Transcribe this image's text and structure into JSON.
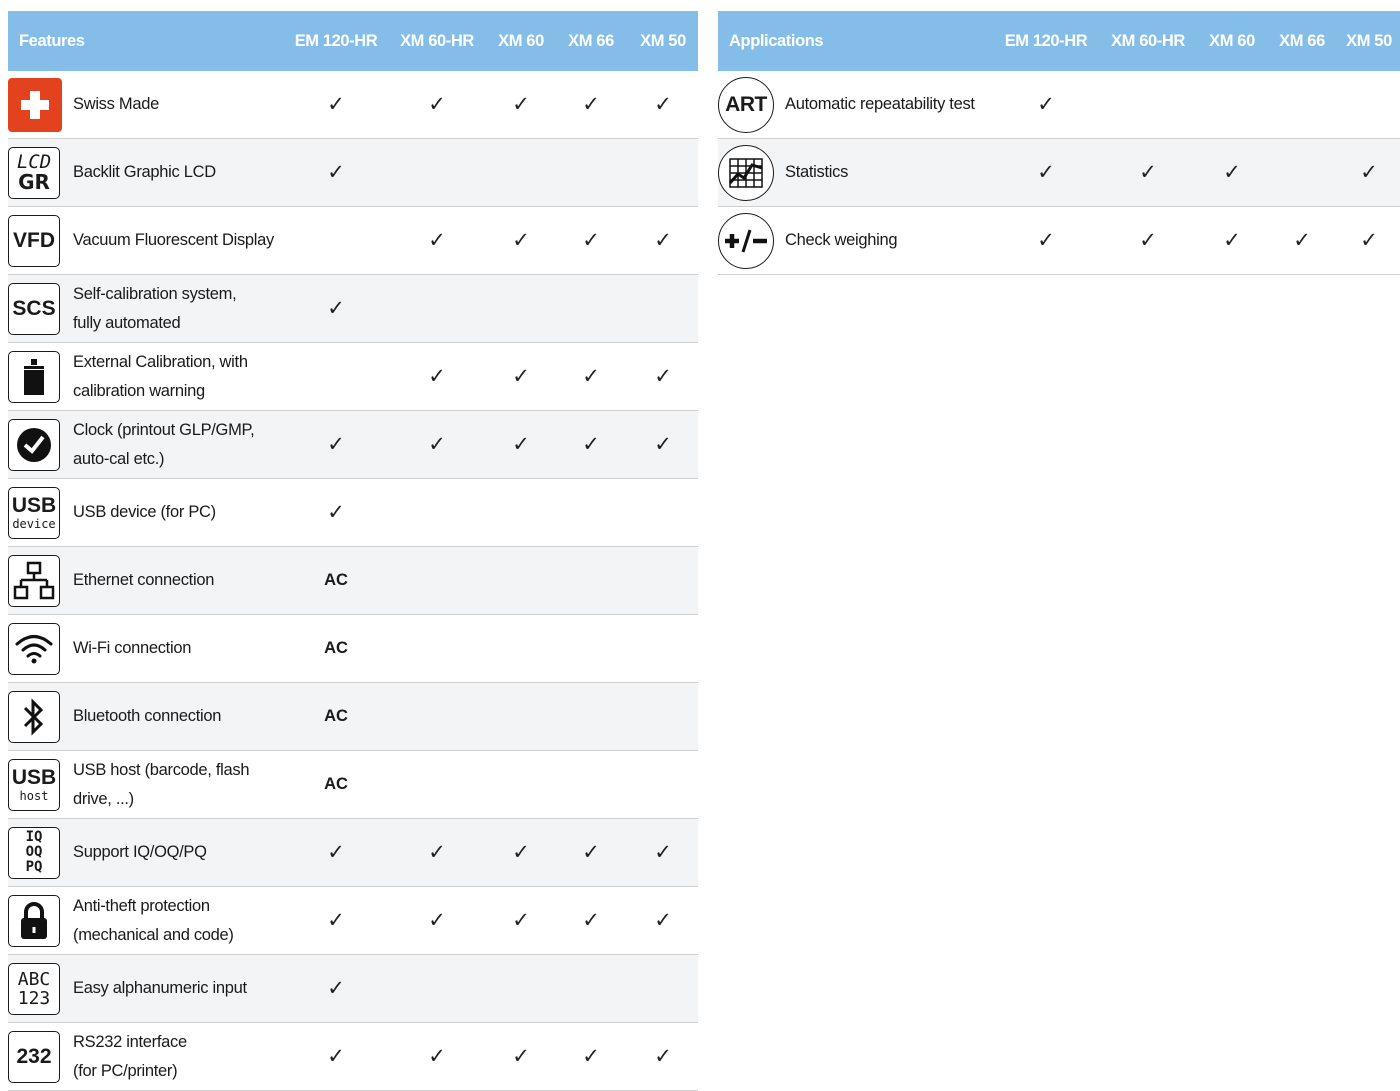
{
  "features": {
    "header": "Features",
    "columns": [
      "EM 120-HR",
      "XM 60-HR",
      "XM 60",
      "XM 66",
      "XM 50"
    ],
    "rows": [
      {
        "icon": "swiss-flag-icon",
        "label_lines": [
          "Swiss Made"
        ],
        "marks": [
          "✓",
          "✓",
          "✓",
          "✓",
          "✓"
        ]
      },
      {
        "icon": "lcd-gr-icon",
        "label_lines": [
          "Backlit Graphic LCD"
        ],
        "marks": [
          "✓",
          "",
          "",
          "",
          ""
        ]
      },
      {
        "icon": "vfd-icon",
        "label_lines": [
          "Vacuum Fluorescent Display"
        ],
        "marks": [
          "",
          "✓",
          "✓",
          "✓",
          "✓"
        ]
      },
      {
        "icon": "scs-icon",
        "label_lines": [
          "Self-calibration system,",
          "fully automated"
        ],
        "marks": [
          "✓",
          "",
          "",
          "",
          ""
        ]
      },
      {
        "icon": "calibration-weight-icon",
        "label_lines": [
          "External Calibration, with",
          "calibration warning"
        ],
        "marks": [
          "",
          "✓",
          "✓",
          "✓",
          "✓"
        ]
      },
      {
        "icon": "clock-icon",
        "label_lines": [
          "Clock (printout GLP/GMP,",
          "auto-cal etc.)"
        ],
        "marks": [
          "✓",
          "✓",
          "✓",
          "✓",
          "✓"
        ]
      },
      {
        "icon": "usb-device-icon",
        "label_lines": [
          "USB device (for PC)"
        ],
        "marks": [
          "✓",
          "",
          "",
          "",
          ""
        ]
      },
      {
        "icon": "ethernet-icon",
        "label_lines": [
          "Ethernet connection"
        ],
        "marks": [
          "AC",
          "",
          "",
          "",
          ""
        ]
      },
      {
        "icon": "wifi-icon",
        "label_lines": [
          "Wi-Fi connection"
        ],
        "marks": [
          "AC",
          "",
          "",
          "",
          ""
        ]
      },
      {
        "icon": "bluetooth-icon",
        "label_lines": [
          "Bluetooth connection"
        ],
        "marks": [
          "AC",
          "",
          "",
          "",
          ""
        ]
      },
      {
        "icon": "usb-host-icon",
        "label_lines": [
          "USB host (barcode, flash",
          "drive, ...)"
        ],
        "marks": [
          "AC",
          "",
          "",
          "",
          ""
        ]
      },
      {
        "icon": "iq-oq-pq-icon",
        "label_lines": [
          "Support IQ/OQ/PQ"
        ],
        "marks": [
          "✓",
          "✓",
          "✓",
          "✓",
          "✓"
        ]
      },
      {
        "icon": "padlock-icon",
        "label_lines": [
          "Anti-theft protection",
          "(mechanical and code)"
        ],
        "marks": [
          "✓",
          "✓",
          "✓",
          "✓",
          "✓"
        ]
      },
      {
        "icon": "abc-123-icon",
        "label_lines": [
          "Easy alphanumeric input"
        ],
        "marks": [
          "✓",
          "",
          "",
          "",
          ""
        ]
      },
      {
        "icon": "rs232-icon",
        "label_lines": [
          "RS232 interface",
          "(for PC/printer)"
        ],
        "marks": [
          "✓",
          "✓",
          "✓",
          "✓",
          "✓"
        ]
      }
    ]
  },
  "applications": {
    "header": "Applications",
    "columns": [
      "EM 120-HR",
      "XM 60-HR",
      "XM 60",
      "XM 66",
      "XM 50"
    ],
    "rows": [
      {
        "icon": "art-icon",
        "label_lines": [
          "Automatic repeatability test"
        ],
        "marks": [
          "✓",
          "",
          "",
          "",
          ""
        ]
      },
      {
        "icon": "statistics-chart-icon",
        "label_lines": [
          "Statistics"
        ],
        "marks": [
          "✓",
          "✓",
          "✓",
          "",
          "✓"
        ]
      },
      {
        "icon": "plus-minus-icon",
        "label_lines": [
          "Check weighing"
        ],
        "marks": [
          "✓",
          "✓",
          "✓",
          "✓",
          "✓"
        ]
      }
    ]
  },
  "icon_text": {
    "lcd_top": "LCD",
    "lcd_bottom": "GR",
    "vfd": "VFD",
    "scs": "SCS",
    "usb": "USB",
    "usb_device_sub": "device",
    "usb_host_sub": "host",
    "iq": "IQ",
    "oq": "OQ",
    "pq": "PQ",
    "abc": "ABC",
    "num": "123",
    "rs232": "232",
    "art": "ART"
  },
  "colors": {
    "header_bg": "#85bde9",
    "swiss_red": "#e2421e"
  }
}
